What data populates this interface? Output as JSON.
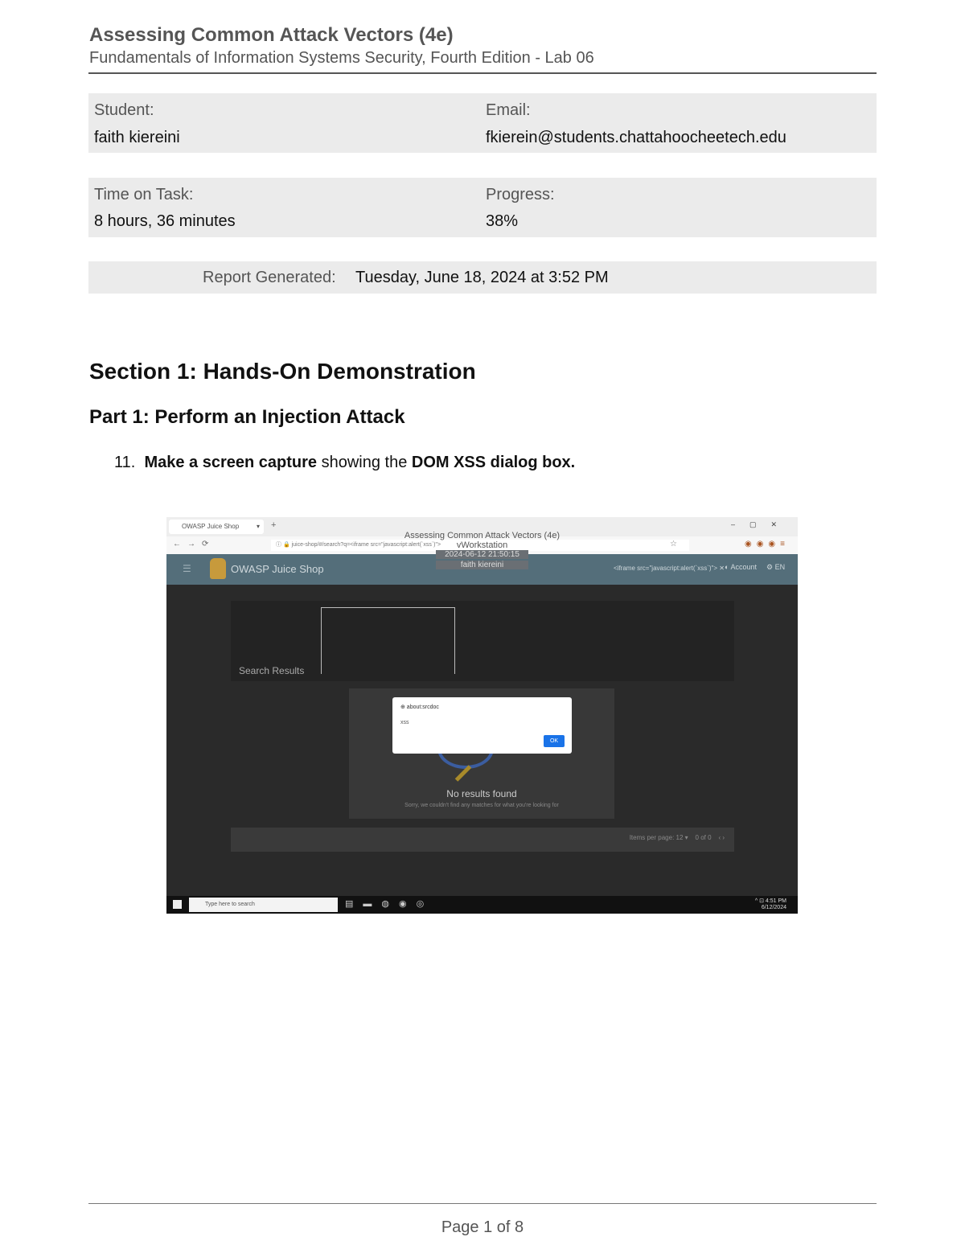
{
  "header": {
    "title": "Assessing Common Attack Vectors (4e)",
    "subtitle": "Fundamentals of Information Systems Security, Fourth Edition - Lab 06"
  },
  "info": {
    "student_label": "Student:",
    "student_value": "faith kiereini",
    "email_label": "Email:",
    "email_value": "fkierein@students.chattahoocheetech.edu",
    "time_label": "Time on Task:",
    "time_value": "8 hours, 36 minutes",
    "progress_label": "Progress:",
    "progress_value": "38%",
    "report_label": "Report Generated:",
    "report_value": "Tuesday, June 18, 2024 at 3:52 PM"
  },
  "content": {
    "section_title": "Section 1: Hands-On Demonstration",
    "part_title": "Part 1: Perform an Injection Attack",
    "item_number": "11.",
    "item_bold1": "Make a screen capture",
    "item_mid": " showing the ",
    "item_bold2": "DOM XSS dialog box."
  },
  "screenshot": {
    "tab_label": "OWASP Juice Shop",
    "watermark_title": "Assessing Common Attack Vectors (4e)",
    "watermark_host": "vWorkstation",
    "watermark_time": "2024-06-12 21:50:15",
    "watermark_user": "faith kiereini",
    "app_title": "OWASP Juice Shop",
    "account_label": "Account",
    "search_results_label": "Search Results",
    "no_results": "No results found",
    "dialog_ok": "OK",
    "taskbar_search": "Type here to search"
  },
  "footer": {
    "page": "Page 1 of 8"
  }
}
